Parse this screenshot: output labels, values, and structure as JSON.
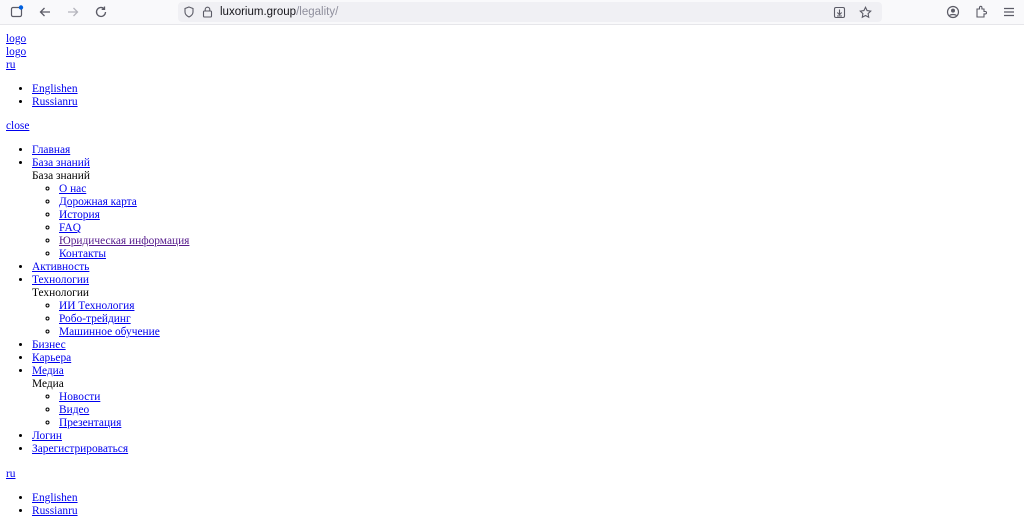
{
  "browser": {
    "url_host": "luxorium.group",
    "url_path": "/legality/"
  },
  "page": {
    "logo1": "logo",
    "logo2": "logo",
    "lang_current": "ru",
    "lang_options": [
      "Englishen",
      "Russianru"
    ],
    "close": "close",
    "menu": {
      "home": "Главная",
      "kb": "База знаний",
      "kb_heading": "База знаний",
      "kb_items": [
        "О нас",
        "Дорожная карта",
        "История",
        "FAQ",
        "Юридическая информация",
        "Контакты"
      ],
      "activity": "Активность",
      "tech": "Технологии",
      "tech_heading": "Технологии",
      "tech_items": [
        "ИИ Технология",
        "Робо-трейдинг",
        "Машинное обучение"
      ],
      "business": "Бизнес",
      "career": "Карьера",
      "media": "Медиа",
      "media_heading": "Медиа",
      "media_items": [
        "Новости",
        "Видео",
        "Презентация"
      ],
      "login": "Логин",
      "register": "Зарегистрироваться"
    },
    "lang_current_2": "ru",
    "lang_options_2": [
      "Englishen",
      "Russianru"
    ]
  }
}
